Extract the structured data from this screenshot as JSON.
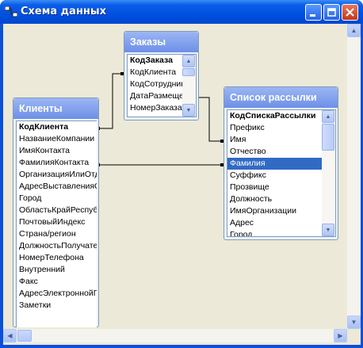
{
  "window": {
    "title": "Схема данных"
  },
  "tables": {
    "clients": {
      "title": "Клиенты",
      "fields": [
        "КодКлиента",
        "НазваниеКомпании",
        "ИмяКонтакта",
        "ФамилияКонтакта",
        "ОрганизацияИлиОтдел",
        "АдресВыставленияСчета",
        "Город",
        "ОбластьКрайРеспублика",
        "ПочтовыйИндекс",
        "Страна/регион",
        "ДолжностьПолучателя",
        "НомерТелефона",
        "Внутренний",
        "Факс",
        "АдресЭлектроннойПочты",
        "Заметки"
      ]
    },
    "orders": {
      "title": "Заказы",
      "fields": [
        "КодЗаказа",
        "КодКлиента",
        "КодСотрудника",
        "ДатаРазмещения",
        "НомерЗаказа"
      ]
    },
    "mailing": {
      "title": "Список рассылки",
      "fields": [
        "КодСпискаРассылки",
        "Префикс",
        "Имя",
        "Отчество",
        "Фамилия",
        "Суффикс",
        "Прозвище",
        "Должность",
        "ИмяОрганизации",
        "Адрес",
        "Город"
      ],
      "selected_field": "Фамилия"
    }
  },
  "icons": {
    "app": "relationships-icon",
    "minimize": "minimize-icon",
    "maximize": "maximize-icon",
    "close": "close-icon"
  }
}
